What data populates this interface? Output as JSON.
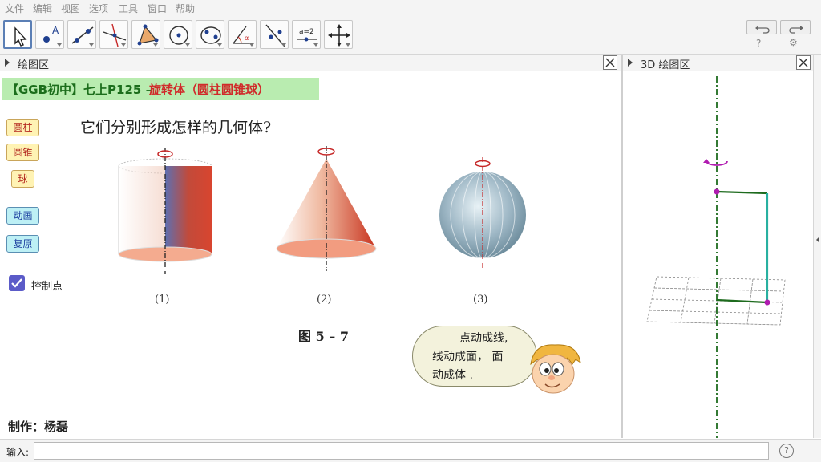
{
  "menu": [
    "文件",
    "编辑",
    "视图",
    "选项",
    "工具",
    "窗口",
    "帮助"
  ],
  "toolbar": {
    "tools": [
      "move-tool",
      "point-tool",
      "line-tool",
      "perpendicular-tool",
      "polygon-tool",
      "circle-tool",
      "conic-tool",
      "angle-tool",
      "reflect-tool",
      "slider-tool",
      "move-view-tool"
    ],
    "slider_tool_label": "a=2",
    "undo_icon": "undo-icon",
    "redo_icon": "redo-icon",
    "help_glyph": "?",
    "settings_glyph": "⚙"
  },
  "graphics_panel": {
    "title": "绘图区"
  },
  "graphics3d_panel": {
    "title": "3D 绘图区"
  },
  "banner": {
    "prefix": "【GGB初中】七上P125 –",
    "topic": "旋转体（圆柱圆锥球）"
  },
  "buttons": {
    "cylinder": "圆柱",
    "cone": "圆锥",
    "sphere": "球",
    "animate": "动画",
    "reset": "复原"
  },
  "checkbox": {
    "label": "控制点",
    "checked": true
  },
  "question": "它们分别形成怎样的几何体?",
  "captions": [
    "(1)",
    "(2)",
    "(3)"
  ],
  "figure_title": "图 5 – 7",
  "bubble": [
    "点动成线,",
    "线动成面， 面",
    "动成体 ."
  ],
  "author": "制作：杨磊",
  "input": {
    "label": "输入:",
    "value": "",
    "help": "?"
  },
  "colors": {
    "banner_bg": "#b9ecb0",
    "banner_green": "#1c6e1c",
    "banner_red": "#d02a2a",
    "axis_green": "#1e6b1e",
    "point_magenta": "#b01cb0",
    "line_teal": "#28b0a0"
  }
}
